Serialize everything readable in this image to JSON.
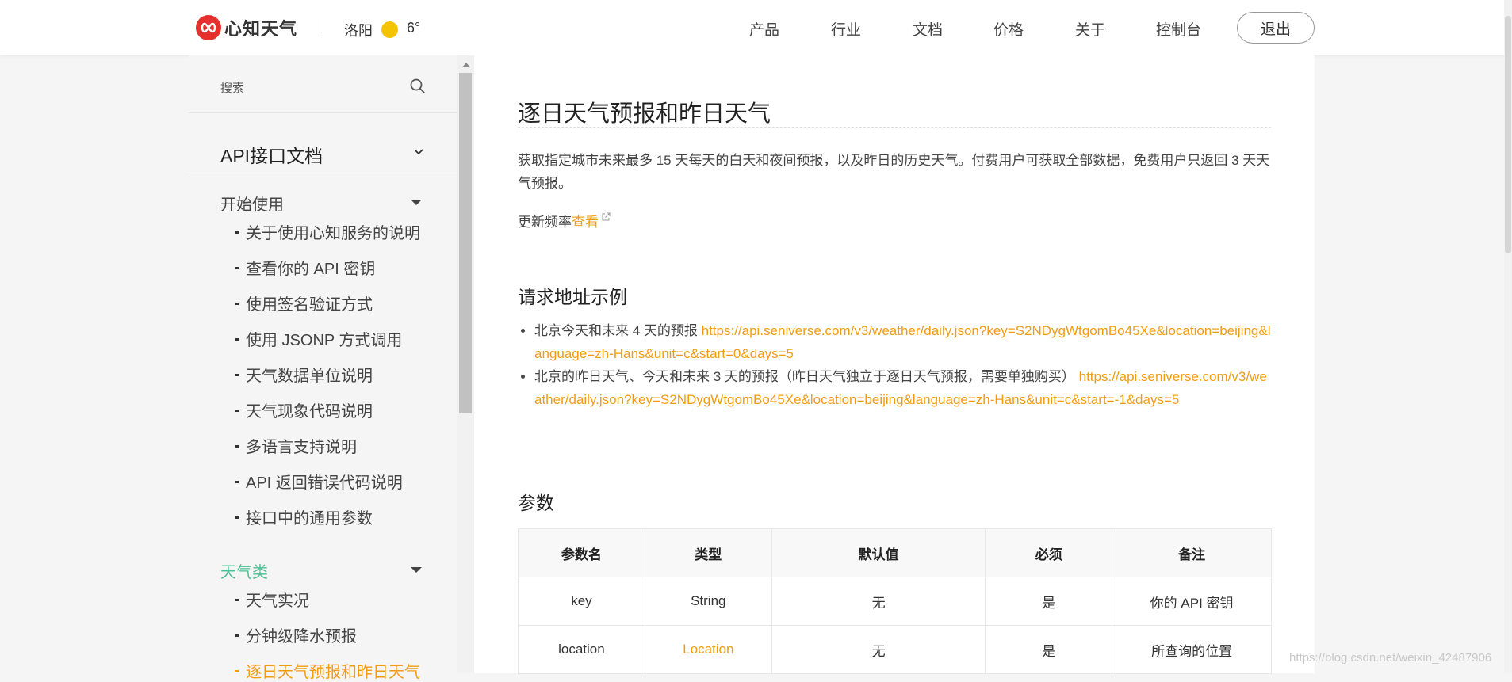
{
  "header": {
    "logo_text": "心知天气",
    "city": "洛阳",
    "temperature": "6°",
    "nav": [
      "产品",
      "行业",
      "文档",
      "价格",
      "关于",
      "控制台"
    ],
    "logout": "退出"
  },
  "sidebar": {
    "search_label": "搜索",
    "api_title": "API接口文档",
    "group_start": "开始使用",
    "start_items": [
      "关于使用心知服务的说明",
      "查看你的 API 密钥",
      "使用签名验证方式",
      "使用 JSONP 方式调用",
      "天气数据单位说明",
      "天气现象代码说明",
      "多语言支持说明",
      "API 返回错误代码说明",
      "接口中的通用参数"
    ],
    "group_weather": "天气类",
    "weather_items": [
      "天气实况",
      "分钟级降水预报",
      "逐日天气预报和昨日天气"
    ]
  },
  "main": {
    "title": "逐日天气预报和昨日天气",
    "description": "获取指定城市未来最多 15 天每天的白天和夜间预报，以及昨日的历史天气。付费用户可获取全部数据，免费用户只返回 3 天天气预报。",
    "freq_label": "更新频率",
    "freq_link": "查看",
    "examples_heading": "请求地址示例",
    "examples": [
      {
        "text": "北京今天和未来 4 天的预报 ",
        "url": "https://api.seniverse.com/v3/weather/daily.json?key=S2NDygWtgomBo45Xe&location=beijing&language=zh-Hans&unit=c&start=0&days=5"
      },
      {
        "text": "北京的昨日天气、今天和未来 3 天的预报（昨日天气独立于逐日天气预报，需要单独购买） ",
        "url": "https://api.seniverse.com/v3/weather/daily.json?key=S2NDygWtgomBo45Xe&location=beijing&language=zh-Hans&unit=c&start=-1&days=5"
      }
    ],
    "params_heading": "参数",
    "table": {
      "headers": [
        "参数名",
        "类型",
        "默认值",
        "必须",
        "备注"
      ],
      "rows": [
        [
          "key",
          "String",
          "无",
          "是",
          "你的 API 密钥"
        ],
        [
          "location",
          "Location",
          "无",
          "是",
          "所查询的位置"
        ]
      ]
    }
  },
  "watermark": "https://blog.csdn.net/weixin_42487906",
  "colors": {
    "accent": "#f39c12",
    "active_group": "#4fbf94",
    "logo_red": "#e5312d",
    "sun": "#f5c400"
  }
}
